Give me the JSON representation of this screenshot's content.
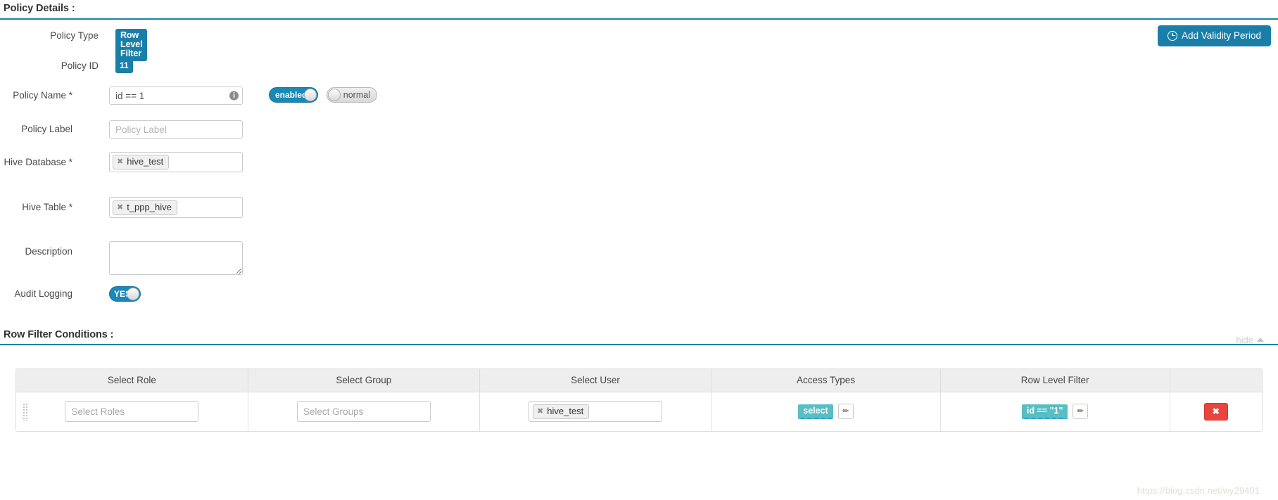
{
  "policy_details": {
    "section_title": "Policy Details :",
    "add_validity_button": "Add Validity Period",
    "fields": {
      "policy_type_label": "Policy Type",
      "policy_type_value": "Row Level Filter",
      "policy_id_label": "Policy ID",
      "policy_id_value": "11",
      "policy_name_label": "Policy Name *",
      "policy_name_value": "id == 1",
      "policy_name_info_icon": "info-icon",
      "policy_label_label": "Policy Label",
      "policy_label_placeholder": "Policy Label",
      "policy_label_value": "",
      "hive_database_label": "Hive Database *",
      "hive_database_token": "hive_test",
      "hive_table_label": "Hive Table *",
      "hive_table_token": "t_ppp_hive",
      "description_label": "Description",
      "description_value": "",
      "audit_logging_label": "Audit Logging"
    },
    "toggles": {
      "enabled_label": "enabled",
      "enabled_state": "on",
      "normal_label": "normal",
      "normal_state": "off",
      "audit_label": "YES",
      "audit_state": "on"
    }
  },
  "row_filter_conditions": {
    "section_title": "Row Filter Conditions :",
    "hide_label": "hide",
    "columns": [
      "Select Role",
      "Select Group",
      "Select User",
      "Access Types",
      "Row Level Filter",
      ""
    ],
    "row": {
      "drag_handle": "drag-handle",
      "roles_placeholder": "Select Roles",
      "roles_value": "",
      "groups_placeholder": "Select Groups",
      "groups_value": "",
      "user_token": "hive_test",
      "access_type_badge": "select",
      "row_filter_badge": "id == \"1\"",
      "edit_icon": "pencil-icon",
      "delete_icon": "close-icon"
    }
  },
  "colors": {
    "accent": "#1a7fa8",
    "teal_badge": "#58bec4",
    "danger": "#e8453c",
    "rule": "#1a7fa8"
  },
  "watermark": "https://blog.csdn.net/wy29401"
}
